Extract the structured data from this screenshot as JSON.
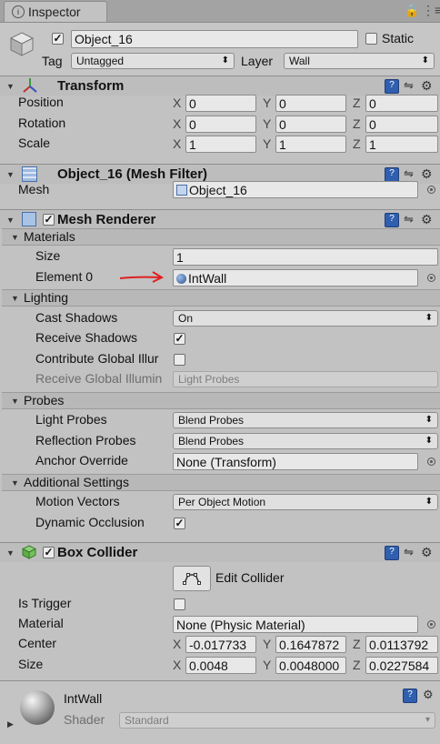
{
  "window": {
    "tab_label": "Inspector",
    "lock_icon": "lock-icon",
    "menu_icon": "kebab-menu-icon"
  },
  "object": {
    "name": "Object_16",
    "static_label": "Static",
    "tag_label": "Tag",
    "tag_value": "Untagged",
    "layer_label": "Layer",
    "layer_value": "Wall",
    "active": true,
    "static": false
  },
  "transform": {
    "title": "Transform",
    "rows": [
      {
        "label": "Position",
        "x": "0",
        "y": "0",
        "z": "0"
      },
      {
        "label": "Rotation",
        "x": "0",
        "y": "0",
        "z": "0"
      },
      {
        "label": "Scale",
        "x": "1",
        "y": "1",
        "z": "1"
      }
    ],
    "axis": {
      "x": "X",
      "y": "Y",
      "z": "Z"
    }
  },
  "mesh_filter": {
    "title": "Object_16 (Mesh Filter)",
    "mesh_label": "Mesh",
    "mesh_value": "Object_16"
  },
  "mesh_renderer": {
    "title": "Mesh Renderer",
    "materials_label": "Materials",
    "size_label": "Size",
    "size_value": "1",
    "element0_label": "Element 0",
    "element0_value": "IntWall",
    "lighting_label": "Lighting",
    "cast_shadows_label": "Cast Shadows",
    "cast_shadows_value": "On",
    "receive_shadows_label": "Receive Shadows",
    "contribute_gi_label": "Contribute Global Illur",
    "receive_gi_label": "Receive Global Illumin",
    "receive_gi_value": "Light Probes",
    "probes_label": "Probes",
    "light_probes_label": "Light Probes",
    "light_probes_value": "Blend Probes",
    "reflection_probes_label": "Reflection Probes",
    "reflection_probes_value": "Blend Probes",
    "anchor_override_label": "Anchor Override",
    "anchor_override_value": "None (Transform)",
    "additional_label": "Additional Settings",
    "motion_vectors_label": "Motion Vectors",
    "motion_vectors_value": "Per Object Motion",
    "dynamic_occlusion_label": "Dynamic Occlusion"
  },
  "box_collider": {
    "title": "Box Collider",
    "edit_collider_label": "Edit Collider",
    "is_trigger_label": "Is Trigger",
    "material_label": "Material",
    "material_value": "None (Physic Material)",
    "center_label": "Center",
    "center_x": "-0.017733",
    "center_y": "0.1647872",
    "center_z": "0.0113792",
    "size_label": "Size",
    "size_x": "0.0048",
    "size_y": "0.0048000",
    "size_z": "0.0227584"
  },
  "material_preview": {
    "name": "IntWall",
    "shader_label": "Shader",
    "shader_value": "Standard"
  },
  "colors": {
    "panel": "#c2c2c2",
    "annotation_arrow": "#e02020",
    "help_icon": "#2f5fae"
  }
}
